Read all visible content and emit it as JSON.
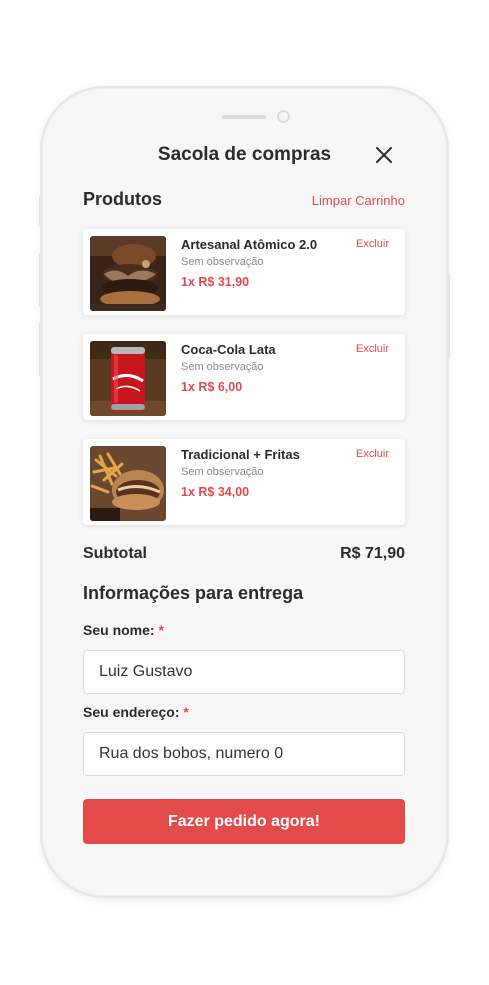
{
  "header": {
    "title": "Sacola de compras",
    "close_icon": "close-icon"
  },
  "products_section": {
    "title": "Produtos",
    "clear_label": "Limpar Carrinho",
    "items": [
      {
        "name": "Artesanal Atômico 2.0",
        "observation": "Sem observação",
        "price": "1x R$ 31,90",
        "delete_label": "Excluir",
        "image": "burger-photo"
      },
      {
        "name": "Coca-Cola Lata",
        "observation": "Sem observação",
        "price": "1x R$ 6,00",
        "delete_label": "Excluir",
        "image": "soda-can-photo"
      },
      {
        "name": "Tradicional + Fritas",
        "observation": "Sem observação",
        "price": "1x R$ 34,00",
        "delete_label": "Excluir",
        "image": "burger-fries-photo"
      }
    ]
  },
  "summary": {
    "subtotal_label": "Subtotal",
    "subtotal_value": "R$ 71,90"
  },
  "delivery": {
    "title": "Informações para entrega",
    "name_label": "Seu nome:",
    "name_value": "Luiz Gustavo",
    "address_label": "Seu endereço:",
    "address_value": "Rua dos bobos, numero 0",
    "required_mark": "*"
  },
  "submit_label": "Fazer pedido agora!",
  "colors": {
    "accent": "#e34a4a",
    "text": "#2b2b2b",
    "muted": "#8a8a8a",
    "background": "#f7f7f7"
  }
}
